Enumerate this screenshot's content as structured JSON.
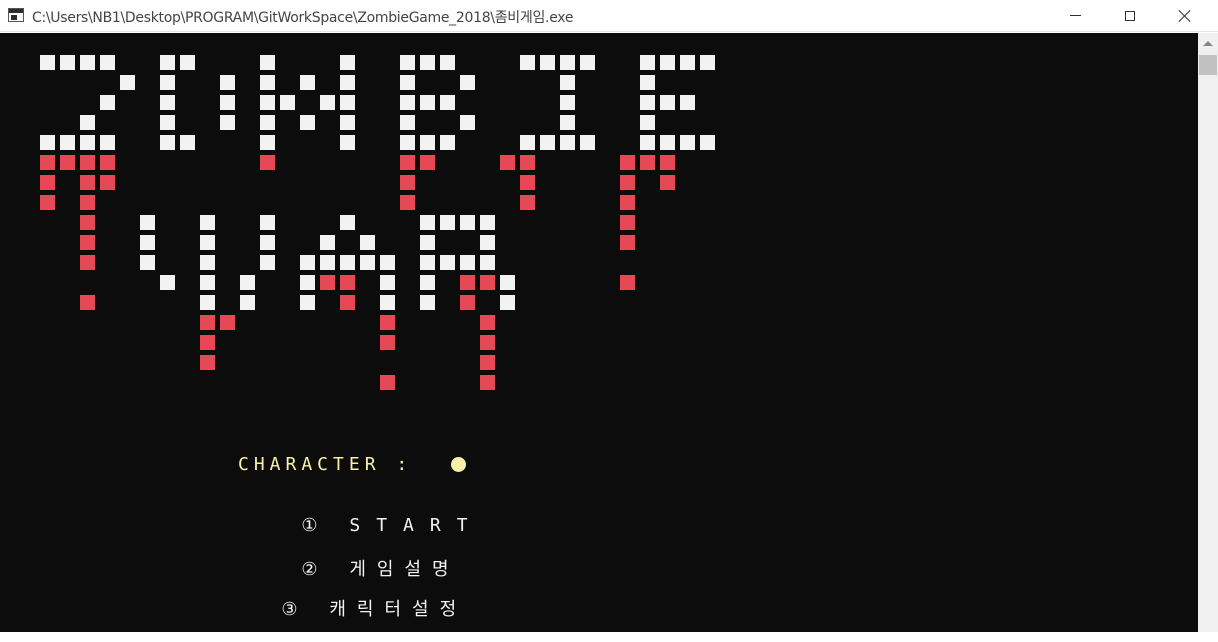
{
  "window": {
    "title": "C:\\Users\\NB1\\Desktop\\PROGRAM\\GitWorkSpace\\ZombieGame_2018\\좀비게임.exe"
  },
  "colors": {
    "console_bg": "#0c0c0c",
    "logo_white": "#f2f2f2",
    "logo_red": "#e74856",
    "character_yellow": "#f9f1a5",
    "menu_text": "#f2f2f2"
  },
  "logo": {
    "rows": [
      "WWWW..WW...W...W..WWW...WWWW..WWWW",
      "....W.W..W.W.W.W..W..W....W...W...",
      "...W..W..W.WW.WW..WWW.....W...WWW.",
      "..W...W..W.W.W.W..W..W....W...W...",
      "WWWW..WW...W...W..WWW...WWWW..WWWW",
      "RRRR.......R......RR...RR....RRR",
      "R.RR..............R.....R....R.R",
      "R.R...............R.....R....R..",
      "..R..W..W..W...W...WWWW......R...",
      "..R..W..W..W..W.W..W..W......R...",
      "..R..W..W..W.WWWWW.WWWW.........",
      "......W.W.W..WRR.W.W.RRW.....R..",
      "..R.....W.W..W.R.W.W.R.W........",
      "........RR.......R....R.........",
      "........R........R....R.........",
      "........R.............R.........",
      ".................R....R........."
    ]
  },
  "menu": {
    "character_label": "CHARACTER :",
    "character_icon": "filled-circle",
    "options": [
      {
        "number": "①",
        "label": "START"
      },
      {
        "number": "②",
        "label": "게임설명"
      },
      {
        "number": "③",
        "label": "캐릭터설정"
      }
    ]
  }
}
